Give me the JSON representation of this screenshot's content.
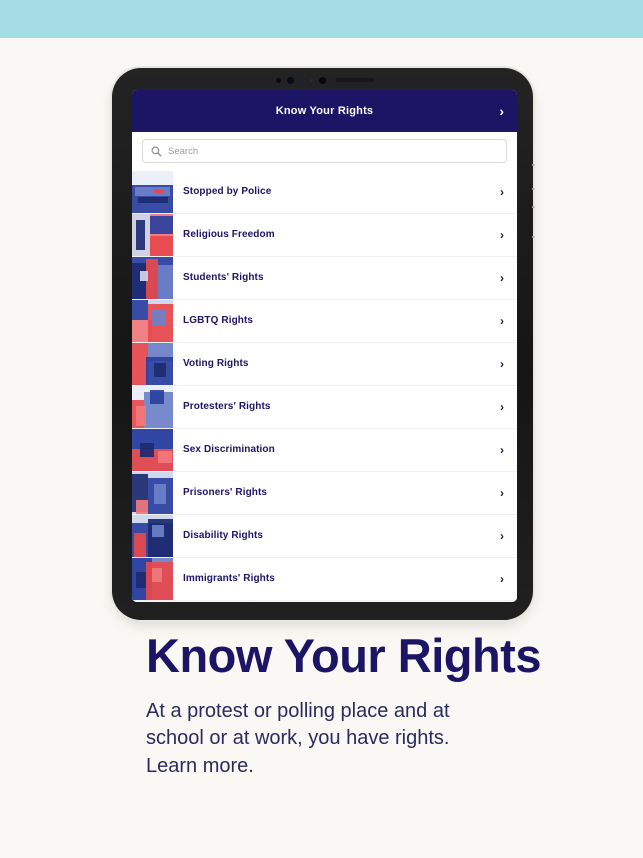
{
  "banner": {
    "color": "#a5dde5"
  },
  "device": {
    "type": "tablet",
    "frame_color": "#1d1d1d",
    "sensors": [
      "camera-dot",
      "camera-dot",
      "sensor-dot",
      "sensor-dot",
      "camera-dot"
    ]
  },
  "app": {
    "header": {
      "title": "Know Your Rights",
      "chevron": "›",
      "background": "#1c1464",
      "text_color": "#ffffff"
    },
    "search": {
      "placeholder": "Search",
      "value": "",
      "icon": "search-icon"
    },
    "list": {
      "accent": "#1c1464",
      "chevron": "›",
      "items": [
        {
          "label": "Stopped by Police",
          "thumb": "police-car-photo"
        },
        {
          "label": "Religious Freedom",
          "thumb": "worshipper-silhouette-photo"
        },
        {
          "label": "Students' Rights",
          "thumb": "students-crowd-photo"
        },
        {
          "label": "LGBTQ Rights",
          "thumb": "pride-portrait-photo"
        },
        {
          "label": "Voting Rights",
          "thumb": "voter-booth-photo"
        },
        {
          "label": "Protesters' Rights",
          "thumb": "protest-signs-photo"
        },
        {
          "label": "Sex Discrimination",
          "thumb": "workplace-photo"
        },
        {
          "label": "Prisoners' Rights",
          "thumb": "prison-payphone-photo"
        },
        {
          "label": "Disability Rights",
          "thumb": "wheelchair-user-photo"
        },
        {
          "label": "Immigrants' Rights",
          "thumb": "immigrant-family-photo"
        }
      ]
    }
  },
  "promo": {
    "headline": "Know Your Rights",
    "subcopy": "At a protest or polling place and at school or at work, you have rights. Learn more.",
    "headline_color": "#1c1464"
  }
}
